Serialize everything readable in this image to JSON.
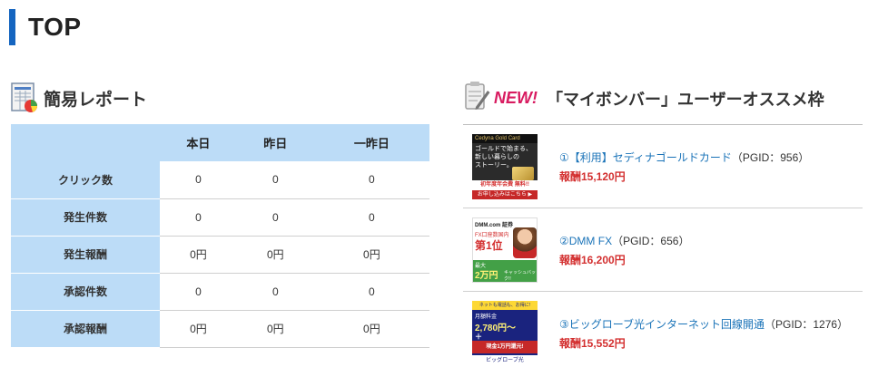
{
  "page": {
    "title": "TOP"
  },
  "report": {
    "heading": "簡易レポート",
    "columns": [
      "本日",
      "昨日",
      "一昨日"
    ],
    "rows": [
      {
        "label": "クリック数",
        "values": [
          "0",
          "0",
          "0"
        ]
      },
      {
        "label": "発生件数",
        "values": [
          "0",
          "0",
          "0"
        ]
      },
      {
        "label": "発生報酬",
        "values": [
          "0円",
          "0円",
          "0円"
        ]
      },
      {
        "label": "承認件数",
        "values": [
          "0",
          "0",
          "0"
        ]
      },
      {
        "label": "承認報酬",
        "values": [
          "0円",
          "0円",
          "0円"
        ]
      }
    ]
  },
  "recommend": {
    "badge": "NEW!",
    "heading": "「マイボンバー」ユーザーオススメ枠",
    "items": [
      {
        "link": "①【利用】セディナゴールドカード",
        "pgid": "（PGID：956）",
        "reward": "報酬15,120円",
        "banner": {
          "line1": "Cedyna Gold Card",
          "line2": "ゴールドで始まる、",
          "line3": "新しい暮らしの",
          "line4": "ストーリー。",
          "line5": "初年度年会費 無料!!",
          "line6": "お申し込みはこちら ▶"
        }
      },
      {
        "link": "②DMM FX",
        "pgid": "（PGID：656）",
        "reward": "報酬16,200円",
        "banner": {
          "line1": "DMM.com 証券",
          "line2": "FX口座数国内",
          "line3": "第1位",
          "line4": "最大",
          "line5": "2万円",
          "line6": "キャッシュバック!!"
        }
      },
      {
        "link": "③ビッグローブ光インターネット回線開通",
        "pgid": "（PGID：1276）",
        "reward": "報酬15,552円",
        "banner": {
          "line1": "ネットも電話も、お得に!",
          "line2": "月額料金",
          "line3": "2,780円～",
          "line4": "＋",
          "line5": "現金1万円還元!",
          "line6": "ビッグローブ光"
        }
      }
    ]
  },
  "colors": {
    "accent": "#1565c0",
    "table_header": "#bcdcf7",
    "link": "#1a73b8",
    "reward": "#d32f2f",
    "new_badge": "#d81b60"
  }
}
